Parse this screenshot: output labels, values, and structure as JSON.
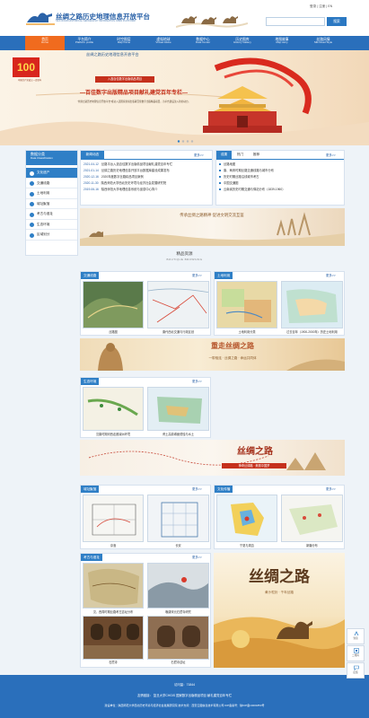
{
  "header": {
    "title": "丝绸之路历史地理信息开放平台",
    "subtitle": "SILK ROAD HISTORICAL GEOGRAPHY INFORMATION OPEN PLATFORM",
    "links": [
      "登录",
      "注册",
      "EN"
    ],
    "search_placeholder": "",
    "search_button": "搜索"
  },
  "nav": [
    {
      "cn": "首页",
      "en": "Home",
      "active": true
    },
    {
      "cn": "平台简介",
      "en": "Platform profile"
    },
    {
      "cn": "时空图层",
      "en": "Map frame"
    },
    {
      "cn": "虚拟地球",
      "en": "Virtual Globe"
    },
    {
      "cn": "数据中心",
      "en": "Data Center"
    },
    {
      "cn": "历史图库",
      "en": "History Gallery"
    },
    {
      "cn": "地图故事",
      "en": "Map story"
    },
    {
      "cn": "丝路风情",
      "en": "Silk Road Style"
    }
  ],
  "banner": {
    "badge": "100",
    "badge_caption": "中国共产党成立一百周年",
    "publisher": "丝绸之路历史地理信息开放平台",
    "tag": "入选百佳数字出版精品项目",
    "title": "—百佳数字出版精品项目献礼建党百年专栏—",
    "desc": "“丝绸之路历史地理信息开放平台”成功入选国家新闻出版署百佳数字出版精品项目，为平台建设注入新的动力。"
  },
  "sidebar": {
    "title_cn": "数据分类",
    "title_en": "Data Classification",
    "items": [
      "文化遗产",
      "交通线路",
      "土地利用",
      "城址聚落",
      "考古与遗址",
      "生态环境",
      "区域划分"
    ],
    "active_index": 0
  },
  "news": {
    "title": "新闻动态",
    "more": "更多>>",
    "items": [
      {
        "date": "2021-04-12",
        "text": "丝路平台入选百佳数字出版精品项目献礼建党百年专栏"
      },
      {
        "date": "2021-01-14",
        "text": "丝绸之路历史地理信息开放平台数据库建设成果发布"
      },
      {
        "date": "2020-12-16",
        "text": "2020年度数字丝路精品项目案例"
      },
      {
        "date": "2020-11-30",
        "text": "陕西师范大学西北历史环境与经济社会发展研究院"
      },
      {
        "date": "2019-06-16",
        "text": "陕西师范大学地理信息系统与遥感中心简介"
      }
    ]
  },
  "tabs": {
    "items": [
      "成果",
      "热门",
      "推荐"
    ],
    "active_index": 0,
    "more": "更多>>",
    "list": [
      "丝路地图",
      "唐、两宋时期丝路交通线路与城市分布",
      "历史时期丝路沿线城市考古",
      "中国交通图",
      "云南省历史时期交通与驿站分布（1839-1960）"
    ]
  },
  "promo": {
    "text": "传承丝绸之路精神 促进文明交流互鉴"
  },
  "boutique": {
    "title": "精品资源",
    "subtitle": "BOUTIQUE BROWSING"
  },
  "sections": {
    "transport": {
      "label": "交通线路",
      "more": "更多>>",
      "captions": [
        "丝路图",
        "唐代西北交通与行政区划"
      ]
    },
    "landuse": {
      "label": "土地利用",
      "more": "更多>>",
      "captions": [
        "土地利用分类",
        "过去百年（1900-2000年）历史土地利用"
      ]
    },
    "banner1": {
      "main": "重走丝绸之路",
      "sub": "一带相连 · 丝绸之路 · 命运共同体"
    },
    "eco": {
      "label": "生态环境",
      "more": "更多>>",
      "captions": [
        "汉唐时期河西走廊绿洲环境",
        "黄土高原塬面侵蚀与水土"
      ]
    },
    "banner2": {
      "main": "丝绸之路",
      "sub": "神奇丝绸路 · 美丽中国梦"
    },
    "city": {
      "label": "城址聚落",
      "more": "更多>>",
      "captions": [
        "京洛",
        "长安"
      ]
    },
    "culture": {
      "label": "文化传播",
      "more": "更多>>",
      "captions": [
        "宁夏与周边",
        "新疆分布"
      ]
    },
    "archaeo": {
      "label": "考古与遗址",
      "more": "更多>>",
      "captions": [
        "汉、西周时期丝路考古遗址分布",
        "晚唐宋元石窟寺研究",
        "石窟寺",
        "石窟寺遗址"
      ]
    },
    "poster": {
      "main": "丝绸之路",
      "sub": "黄沙驼铃 · 千年丝路"
    }
  },
  "footer": {
    "visits_label": "访问量：",
    "visits": "71844",
    "links": "友情链接：  复旦大学CHGIS  国家数字出版精品项目  献礼建党百年专栏",
    "info": "建设单位：陕西师范大学西北历史环境与经济社会发展研究院    技术支持：西安云图信息技术有限公司    ICP备案号：陕ICP备10201853号"
  },
  "float": [
    "到顶",
    "二维码",
    "反馈"
  ],
  "colors": {
    "primary": "#2a6fbb",
    "accent": "#f06b1e",
    "banner_red": "#c5301c"
  }
}
